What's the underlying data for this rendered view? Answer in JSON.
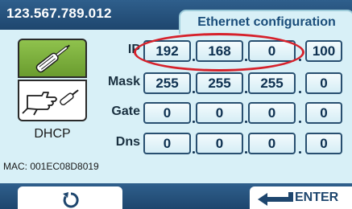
{
  "header": {
    "device_id": "123.567.789.012",
    "tab_title": "Ethernet configuration"
  },
  "mode": {
    "static_icon": "screwdriver-icon",
    "dhcp_icon": "hand-pointing-icon",
    "dhcp_label": "DHCP",
    "selected": "static"
  },
  "network": {
    "rows": [
      {
        "label": "IP",
        "octets": [
          "192",
          "168",
          "0",
          "100"
        ]
      },
      {
        "label": "Mask",
        "octets": [
          "255",
          "255",
          "255",
          "0"
        ]
      },
      {
        "label": "Gate",
        "octets": [
          "0",
          "0",
          "0",
          "0"
        ]
      },
      {
        "label": "Dns",
        "octets": [
          "0",
          "0",
          "0",
          "0"
        ]
      }
    ],
    "highlight_color": "#d6212b"
  },
  "mac": "MAC: 001EC08D8019",
  "footer": {
    "back_icon": "refresh-icon",
    "enter_label": "ENTER",
    "enter_icon": "enter-arrow-icon"
  },
  "colors": {
    "bar": "#1e466e",
    "panel": "#d8f0f7",
    "static_active": "#7aac3c"
  }
}
